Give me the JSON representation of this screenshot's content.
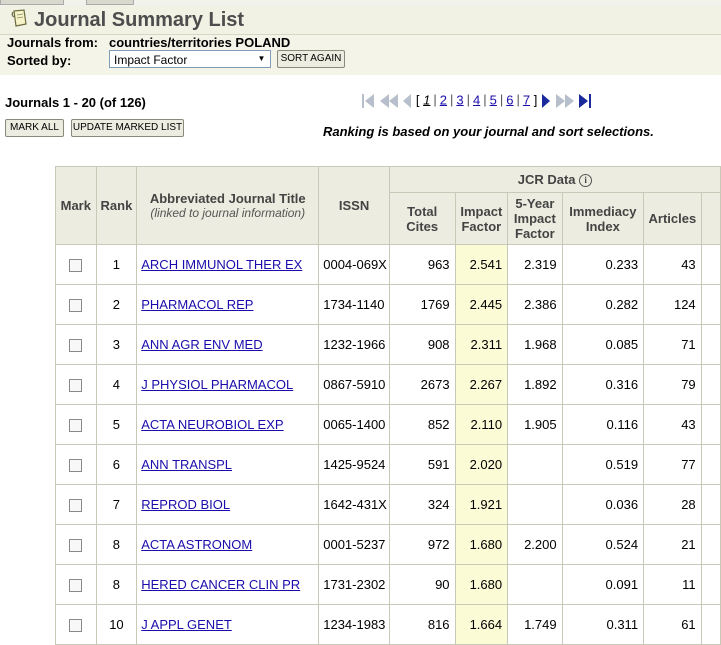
{
  "header": {
    "title": "Journal Summary List"
  },
  "info": {
    "journals_from_label": "Journals from:",
    "journals_from_value": "countries/territories POLAND",
    "sorted_by_label": "Sorted by:",
    "sort_value": "Impact Factor",
    "sort_again_label": "SORT AGAIN"
  },
  "results": {
    "count_text": "Journals 1 - 20 (of 126)",
    "mark_all_label": "MARK ALL",
    "update_marked_label": "UPDATE MARKED LIST",
    "ranking_note": "Ranking is based on your journal and sort selections."
  },
  "pager": {
    "current": "1",
    "pages": [
      "2",
      "3",
      "4",
      "5",
      "6",
      "7"
    ]
  },
  "table": {
    "headers": {
      "mark": "Mark",
      "rank": "Rank",
      "title": "Abbreviated Journal Title",
      "title_sub": "(linked to journal information)",
      "issn": "ISSN",
      "jcr_data": "JCR Data",
      "total_cites": "Total Cites",
      "impact_factor": "Impact Factor",
      "five_year_if": "5-Year Impact Factor",
      "immediacy_index": "Immediacy Index",
      "articles": "Articles"
    },
    "rows": [
      {
        "rank": "1",
        "title": "ARCH IMMUNOL THER EX",
        "issn": "0004-069X",
        "total_cites": "963",
        "impact_factor": "2.541",
        "five_year_if": "2.319",
        "immediacy_index": "0.233",
        "articles": "43"
      },
      {
        "rank": "2",
        "title": "PHARMACOL REP",
        "issn": "1734-1140",
        "total_cites": "1769",
        "impact_factor": "2.445",
        "five_year_if": "2.386",
        "immediacy_index": "0.282",
        "articles": "124"
      },
      {
        "rank": "3",
        "title": "ANN AGR ENV MED",
        "issn": "1232-1966",
        "total_cites": "908",
        "impact_factor": "2.311",
        "five_year_if": "1.968",
        "immediacy_index": "0.085",
        "articles": "71"
      },
      {
        "rank": "4",
        "title": "J PHYSIOL PHARMACOL",
        "issn": "0867-5910",
        "total_cites": "2673",
        "impact_factor": "2.267",
        "five_year_if": "1.892",
        "immediacy_index": "0.316",
        "articles": "79"
      },
      {
        "rank": "5",
        "title": "ACTA NEUROBIOL EXP",
        "issn": "0065-1400",
        "total_cites": "852",
        "impact_factor": "2.110",
        "five_year_if": "1.905",
        "immediacy_index": "0.116",
        "articles": "43"
      },
      {
        "rank": "6",
        "title": "ANN TRANSPL",
        "issn": "1425-9524",
        "total_cites": "591",
        "impact_factor": "2.020",
        "five_year_if": "",
        "immediacy_index": "0.519",
        "articles": "77"
      },
      {
        "rank": "7",
        "title": "REPROD BIOL",
        "issn": "1642-431X",
        "total_cites": "324",
        "impact_factor": "1.921",
        "five_year_if": "",
        "immediacy_index": "0.036",
        "articles": "28"
      },
      {
        "rank": "8",
        "title": "ACTA ASTRONOM",
        "issn": "0001-5237",
        "total_cites": "972",
        "impact_factor": "1.680",
        "five_year_if": "2.200",
        "immediacy_index": "0.524",
        "articles": "21"
      },
      {
        "rank": "8",
        "title": "HERED CANCER CLIN PR",
        "issn": "1731-2302",
        "total_cites": "90",
        "impact_factor": "1.680",
        "five_year_if": "",
        "immediacy_index": "0.091",
        "articles": "11"
      },
      {
        "rank": "10",
        "title": "J APPL GENET",
        "issn": "1234-1983",
        "total_cites": "816",
        "impact_factor": "1.664",
        "five_year_if": "1.749",
        "immediacy_index": "0.311",
        "articles": "61"
      }
    ]
  },
  "icons": {
    "title_icon": "document-note-icon",
    "info_icon": "info-icon",
    "first": "first-page-icon",
    "prev10": "previous-ten-icon",
    "prev": "previous-page-icon",
    "next": "next-page-icon",
    "next10": "next-ten-icon",
    "last": "last-page-icon"
  }
}
